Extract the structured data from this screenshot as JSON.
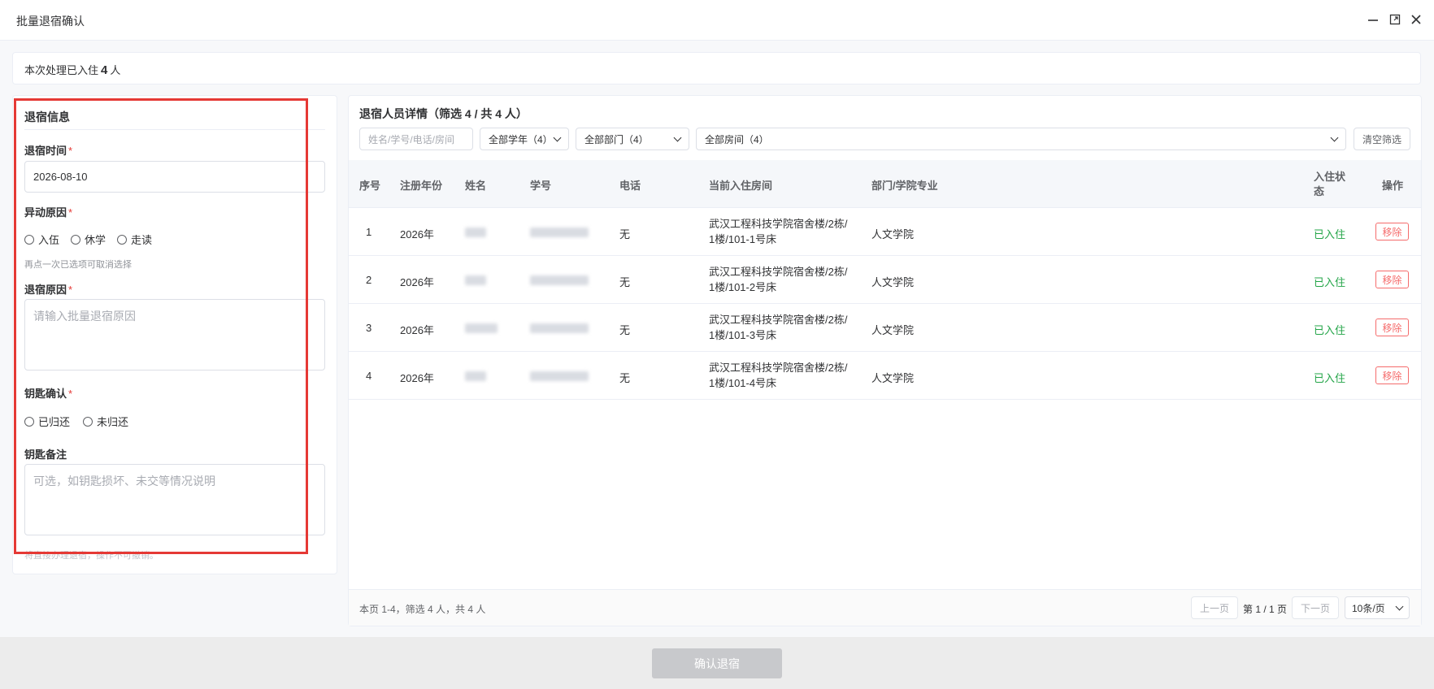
{
  "window": {
    "title": "批量退宿确认"
  },
  "summary": {
    "prefix": "本次处理已入住",
    "count": "4",
    "suffix": "人"
  },
  "form": {
    "section_title": "退宿信息",
    "date_label": "退宿时间",
    "date_value": "2026-08-10",
    "change_reason_label": "异动原因",
    "change_reason_options": [
      "入伍",
      "休学",
      "走读"
    ],
    "change_reason_hint": "再点一次已选项可取消选择",
    "checkout_reason_label": "退宿原因",
    "checkout_reason_placeholder": "请输入批量退宿原因",
    "key_confirm_label": "钥匙确认",
    "key_confirm_options": [
      "已归还",
      "未归还"
    ],
    "key_note_label": "钥匙备注",
    "key_note_placeholder": "可选，如钥匙损坏、未交等情况说明",
    "required_mark": "*",
    "warning": "将直接办理退宿，操作不可撤销。"
  },
  "details": {
    "title": "退宿人员详情（筛选 4 / 共 4 人）",
    "search_placeholder": "姓名/学号/电话/房间",
    "filter_year": "全部学年（4）",
    "filter_dept": "全部部门（4）",
    "filter_room": "全部房间（4）",
    "clear_button": "清空筛选",
    "columns": [
      "序号",
      "注册年份",
      "姓名",
      "学号",
      "电话",
      "当前入住房间",
      "部门/学院专业",
      "入住状态",
      "操作"
    ],
    "rows": [
      {
        "index": "1",
        "year": "2026年",
        "phone": "无",
        "room_line1": "武汉工程科技学院宿舍楼/2栋/",
        "room_line2": "1楼/101-1号床",
        "dept": "人文学院",
        "status": "已入住",
        "action": "移除"
      },
      {
        "index": "2",
        "year": "2026年",
        "phone": "无",
        "room_line1": "武汉工程科技学院宿舍楼/2栋/",
        "room_line2": "1楼/101-2号床",
        "dept": "人文学院",
        "status": "已入住",
        "action": "移除"
      },
      {
        "index": "3",
        "year": "2026年",
        "phone": "无",
        "room_line1": "武汉工程科技学院宿舍楼/2栋/",
        "room_line2": "1楼/101-3号床",
        "dept": "人文学院",
        "status": "已入住",
        "action": "移除"
      },
      {
        "index": "4",
        "year": "2026年",
        "phone": "无",
        "room_line1": "武汉工程科技学院宿舍楼/2栋/",
        "room_line2": "1楼/101-4号床",
        "dept": "人文学院",
        "status": "已入住",
        "action": "移除"
      }
    ]
  },
  "pagination": {
    "info": "本页 1-4，筛选 4 人，共 4 人",
    "prev": "上一页",
    "page": "第 1 / 1 页",
    "next": "下一页",
    "page_size": "10条/页"
  },
  "footer": {
    "confirm_button": "确认退宿"
  },
  "colors": {
    "accent_red": "#e53935",
    "status_green": "#22a447",
    "remove_red": "#f56c6c"
  }
}
